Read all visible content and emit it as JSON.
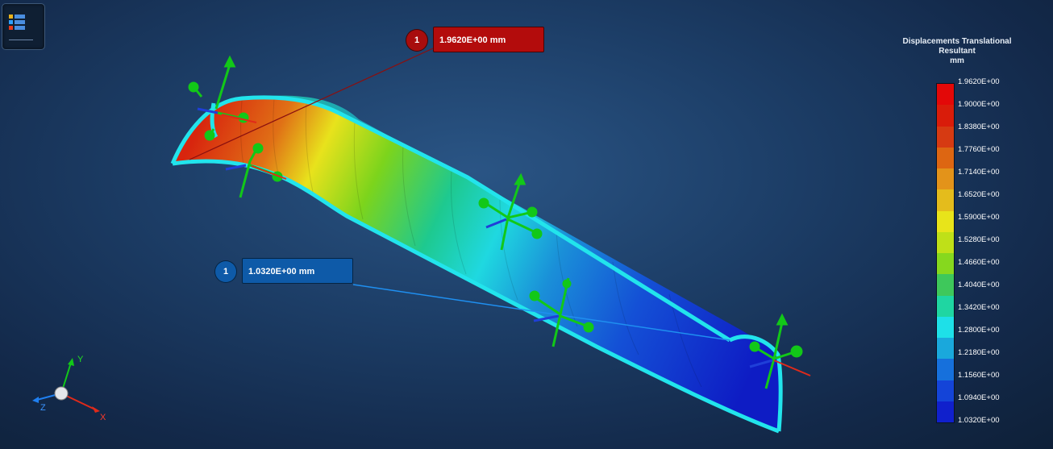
{
  "callouts": {
    "max": {
      "number": "1",
      "value": "1.9620E+00 mm"
    },
    "min": {
      "number": "1",
      "value": "1.0320E+00 mm"
    }
  },
  "legend": {
    "title_line1": "Displacements Translational",
    "title_line2": "Resultant",
    "unit": "mm",
    "values": [
      "1.9620E+00",
      "1.9000E+00",
      "1.8380E+00",
      "1.7760E+00",
      "1.7140E+00",
      "1.6520E+00",
      "1.5900E+00",
      "1.5280E+00",
      "1.4660E+00",
      "1.4040E+00",
      "1.3420E+00",
      "1.2800E+00",
      "1.2180E+00",
      "1.1560E+00",
      "1.0940E+00",
      "1.0320E+00"
    ],
    "colors": [
      "#e30808",
      "#d91c0a",
      "#d63a12",
      "#dd6612",
      "#e3931a",
      "#e4bc1c",
      "#e8e41a",
      "#bfe018",
      "#86d81e",
      "#3ec85b",
      "#1fd6a2",
      "#1ee0e8",
      "#1aa8dc",
      "#1670dc",
      "#1444d8",
      "#1020cc"
    ]
  },
  "triad": {
    "y_label": "Y",
    "z_label": "Z",
    "x_label": "X"
  },
  "icons": {
    "menu": "results-menu-icon"
  },
  "colors": {
    "edge": "#22e4ec",
    "arrow_green": "#12c818",
    "max_tag": "#b30c0c",
    "min_tag": "#0e5aa8"
  }
}
